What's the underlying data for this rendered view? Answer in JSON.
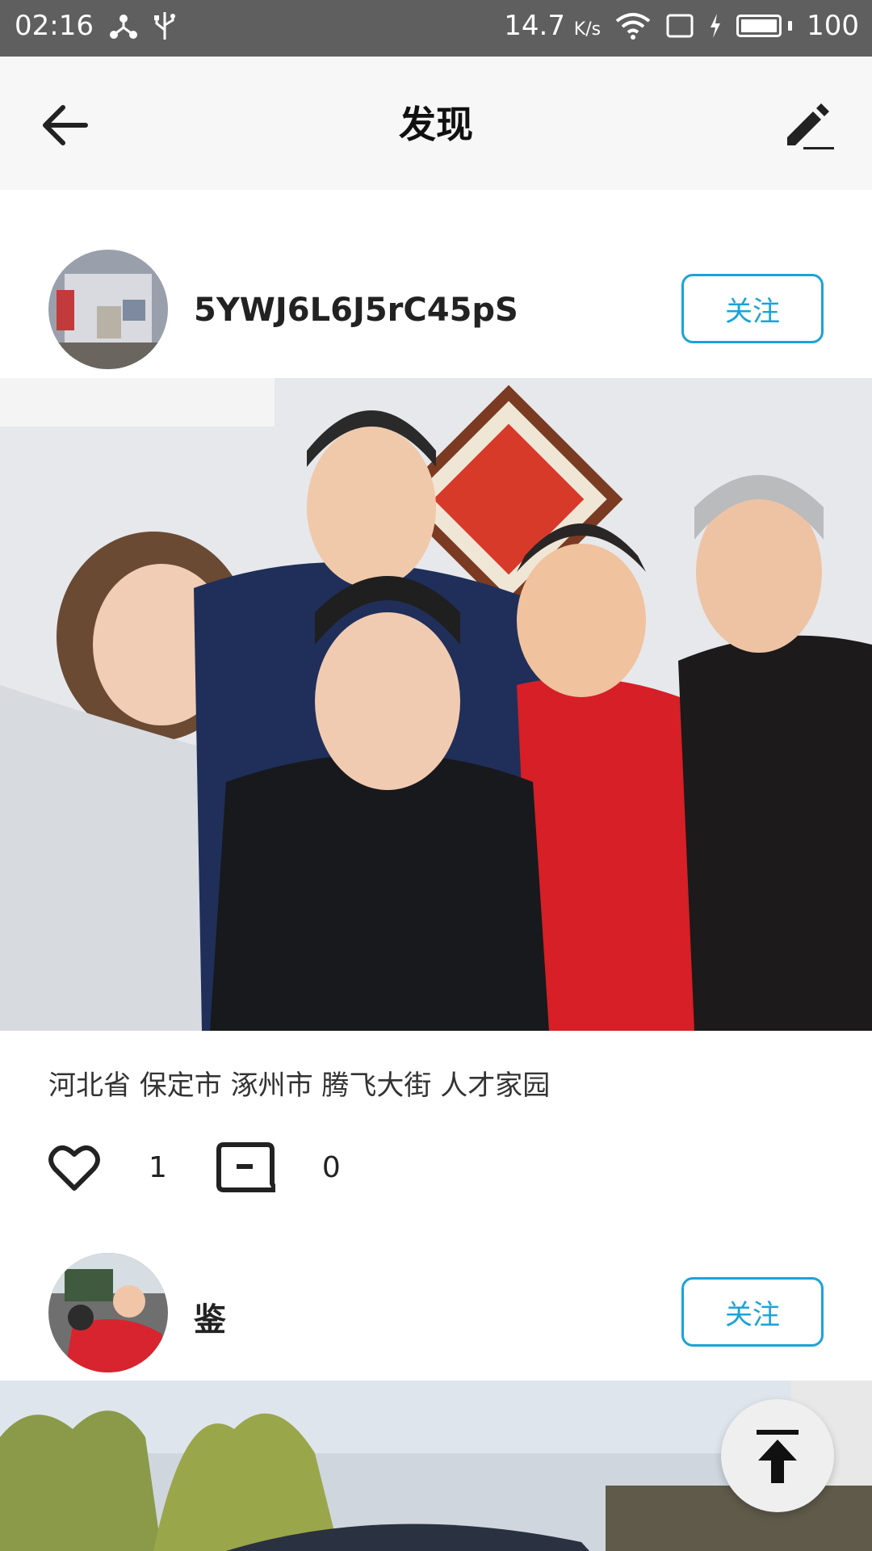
{
  "status_bar": {
    "time": "02:16",
    "network_speed": "14.7",
    "network_unit": "K/s",
    "battery": "100"
  },
  "app_bar": {
    "title": "发现"
  },
  "posts": [
    {
      "username": "5YWJ6L6J5rC45pS",
      "follow_label": "关注",
      "location": "河北省 保定市 涿州市 腾飞大街 人才家园",
      "likes": "1",
      "comments": "0"
    },
    {
      "username": "鉴",
      "follow_label": "关注"
    }
  ],
  "colors": {
    "accent": "#1aa3d8",
    "status_bar": "#5f5f5f",
    "app_bar": "#f7f7f7"
  }
}
